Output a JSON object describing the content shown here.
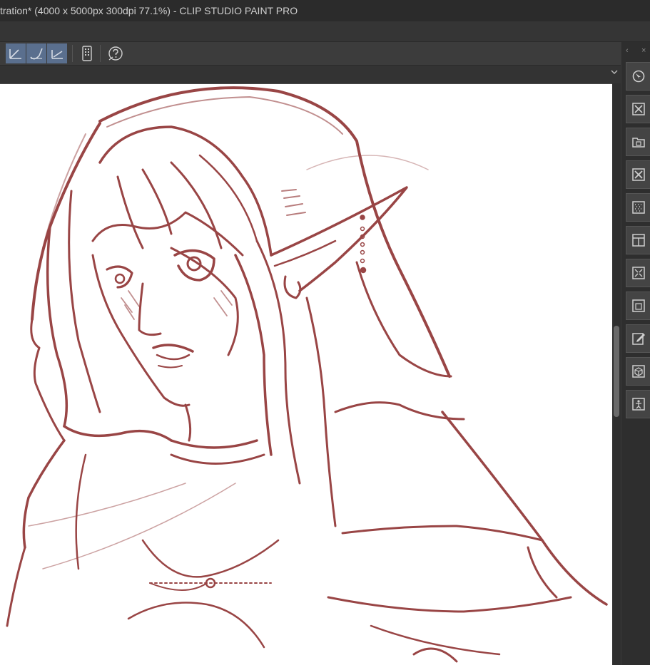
{
  "window": {
    "title": "tration* (4000 x 5000px 300dpi 77.1%)  - CLIP STUDIO PAINT PRO"
  },
  "toolbar": {
    "buttons": [
      {
        "name": "fill-reference-icon",
        "active": true
      },
      {
        "name": "fill-stroke-icon",
        "active": true
      },
      {
        "name": "fill-angle-icon",
        "active": true
      },
      {
        "name": "device-icon",
        "active": false
      },
      {
        "name": "help-icon",
        "active": false
      }
    ]
  },
  "side_panel": {
    "collapse_symbol": "‹",
    "close_symbol": "×",
    "icons": [
      "navigator-icon",
      "material-icon",
      "layer-folder-icon",
      "close-panel-icon",
      "tone-icon",
      "layout-icon",
      "transform-icon",
      "image-icon",
      "edit-icon",
      "3d-cube-icon",
      "figure-icon"
    ]
  },
  "colors": {
    "sketch_stroke": "#8b2c2c",
    "active_tool": "#5a6f8e",
    "panel_bg": "#2e2e2e"
  }
}
